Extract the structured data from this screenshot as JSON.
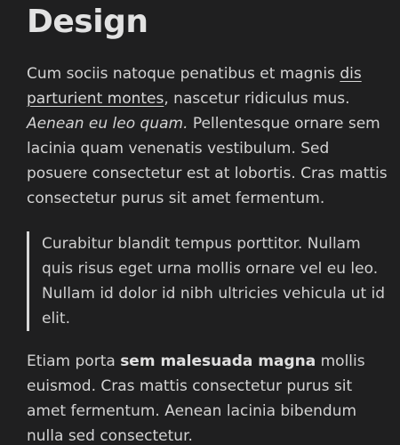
{
  "heading": "Design",
  "para1": {
    "text_start": "Cum sociis natoque penatibus et magnis ",
    "link": "dis parturient montes",
    "text_mid": ", nascetur ridiculus mus. ",
    "italic": "Aenean eu leo quam.",
    "text_end": " Pellentesque ornare sem lacinia quam venenatis vestibulum. Sed posuere consectetur est at lobortis. Cras mattis consectetur purus sit amet fermentum."
  },
  "blockquote": {
    "text": "Curabitur blandit tempus porttitor. Nullam quis risus eget urna mollis ornare vel eu leo. Nullam id dolor id nibh ultricies vehicula ut id elit."
  },
  "para2": {
    "text_start": "Etiam porta ",
    "bold": "sem malesuada magna",
    "text_end": " mollis euismod. Cras mattis consectetur purus sit amet fermentum. Aenean lacinia bibendum nulla sed consectetur."
  },
  "colors": {
    "background": "#1f1f20",
    "text": "#d3d3d3",
    "heading": "#e2e2e2",
    "quote_border": "#d7d7d7"
  }
}
